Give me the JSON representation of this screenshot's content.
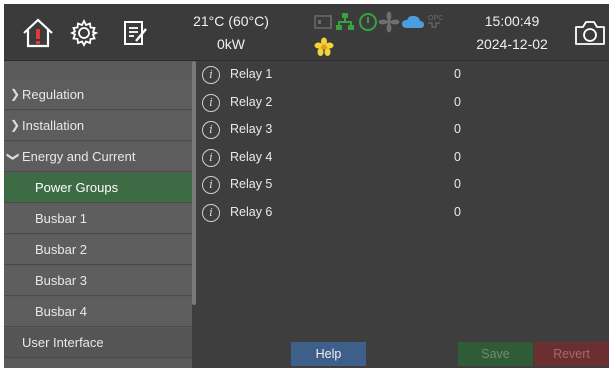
{
  "header": {
    "temperature": "21°C (60°C)",
    "power": "0kW",
    "time": "15:00:49",
    "date": "2024-12-02",
    "icons": [
      "home-alarm-icon",
      "settings-gear-icon",
      "notes-icon",
      "status-indicators-icon",
      "flower-icon",
      "camera-icon"
    ]
  },
  "sidebar": {
    "items": [
      {
        "label": "Regulation",
        "level": "top",
        "expandable": true
      },
      {
        "label": "Installation",
        "level": "top",
        "expandable": true
      },
      {
        "label": "Energy and Current",
        "level": "top",
        "expanded": true
      },
      {
        "label": "Power Groups",
        "level": "sub",
        "selected": true
      },
      {
        "label": "Busbar 1",
        "level": "sub"
      },
      {
        "label": "Busbar 2",
        "level": "sub"
      },
      {
        "label": "Busbar 3",
        "level": "sub"
      },
      {
        "label": "Busbar 4",
        "level": "sub"
      },
      {
        "label": "User Interface",
        "level": "top"
      }
    ]
  },
  "main": {
    "rows": [
      {
        "label": "Relay 1",
        "value": "0"
      },
      {
        "label": "Relay 2",
        "value": "0"
      },
      {
        "label": "Relay 3",
        "value": "0"
      },
      {
        "label": "Relay 4",
        "value": "0"
      },
      {
        "label": "Relay 5",
        "value": "0"
      },
      {
        "label": "Relay 6",
        "value": "0"
      }
    ]
  },
  "footer": {
    "help": "Help",
    "save": "Save",
    "revert": "Revert"
  },
  "colors": {
    "selected": "#3d6b43",
    "help": "#3f5f8b",
    "save": "#2f5b36",
    "revert": "#6b2f31"
  }
}
